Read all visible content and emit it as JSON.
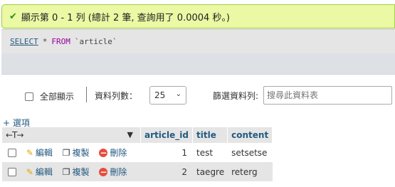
{
  "message": {
    "text": "顯示第 0 - 1 列 (總計 2 筆, 查詢用了 0.0004 秒。)"
  },
  "sql": {
    "select": "SELECT",
    "star": "*",
    "from": "FROM",
    "table": "`article`"
  },
  "controls": {
    "show_all": "全部顯示",
    "rows_label": "資料列數：",
    "rows_value": "25",
    "filter_label": "篩選資料列:",
    "search_placeholder": "搜尋此資料表"
  },
  "options_link": "+ 選項",
  "table": {
    "arrows": "←T→",
    "sort_triangle": "▼",
    "columns": [
      "article_id",
      "title",
      "content"
    ],
    "action_labels": {
      "edit": "編輯",
      "copy": "複製",
      "delete": "刪除"
    },
    "rows": [
      {
        "article_id": "1",
        "title": "test",
        "content": "setsetse"
      },
      {
        "article_id": "2",
        "title": "taegre",
        "content": "reterg"
      }
    ]
  },
  "colors": {
    "success_bg": "#ebf8a4",
    "link": "#235a81",
    "row_alt": "#e5e5e5"
  }
}
